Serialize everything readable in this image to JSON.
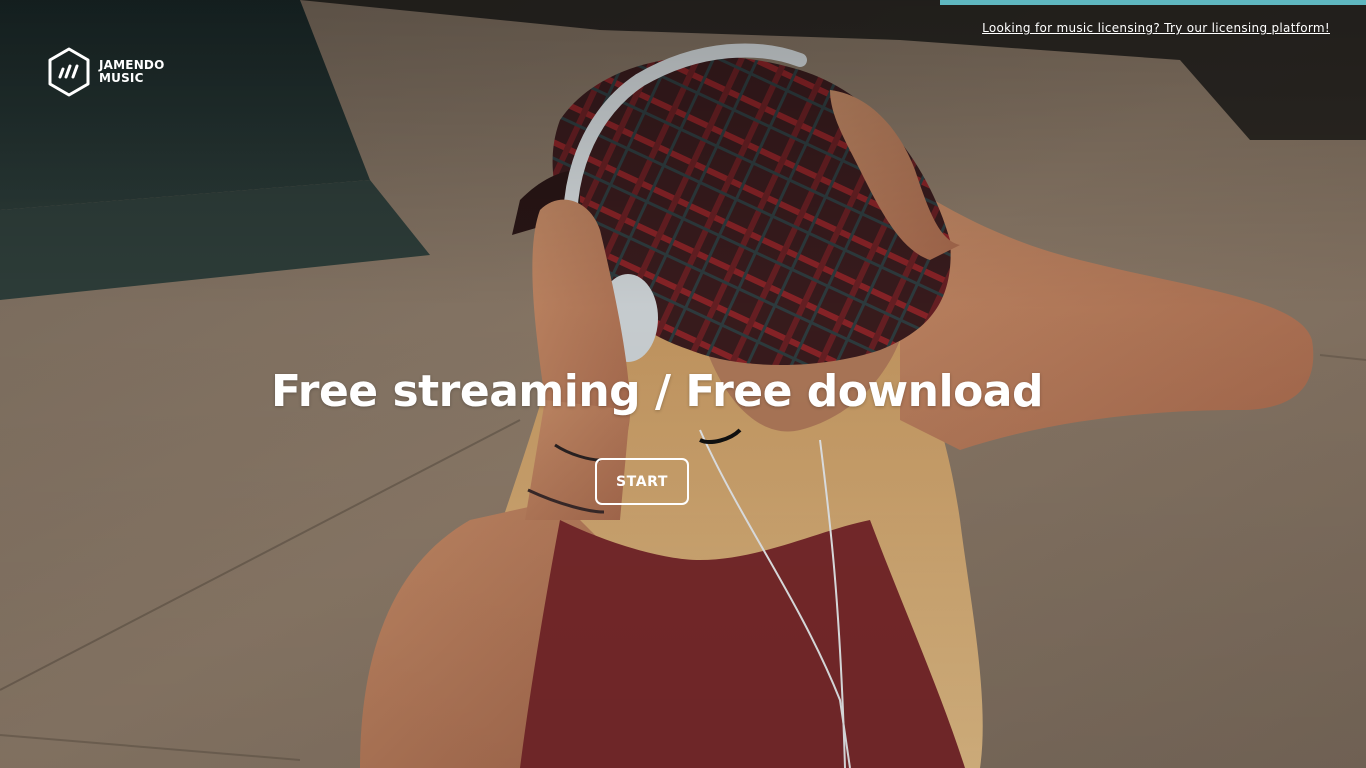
{
  "header": {
    "licensing_link": "Looking for music licensing? Try our licensing platform!",
    "accent_color": "#5fb7c0"
  },
  "logo": {
    "line1": "JAMENDO",
    "line2": "MUSIC",
    "icon": "jamendo-hexagon-icon"
  },
  "hero": {
    "headline": "Free streaming / Free download",
    "cta_label": "START",
    "background_image": "woman-with-headphones-and-plaid-cap"
  }
}
